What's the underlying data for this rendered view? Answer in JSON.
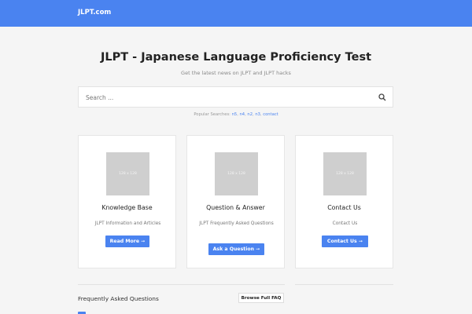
{
  "header": {
    "brand": "JLPT.com"
  },
  "hero": {
    "title": "JLPT - Japanese Language Proficiency Test",
    "subtitle": "Get the latest news on JLPT and JLPT hacks"
  },
  "search": {
    "placeholder": "Search ...",
    "popular_label": "Popular Searches:",
    "popular_terms": [
      "n5",
      "n4",
      "n2",
      "n3",
      "contact"
    ]
  },
  "cards": [
    {
      "image_label": "128 x 128",
      "title": "Knowledge Base",
      "description": "JLPT Information and Articles",
      "button": "Read More ➞"
    },
    {
      "image_label": "128 x 128",
      "title": "Question & Answer",
      "description": "JLPT Frequently Asked Questions",
      "button": "Ask a Question ➞"
    },
    {
      "image_label": "128 x 128",
      "title": "Contact Us",
      "description": "Contact Us",
      "button": "Contact Us ➞"
    }
  ],
  "faq": {
    "title": "Frequently Asked Questions",
    "button": "Browse Full FAQ"
  },
  "colors": {
    "accent": "#4a83f0",
    "background": "#f5f5f5"
  }
}
